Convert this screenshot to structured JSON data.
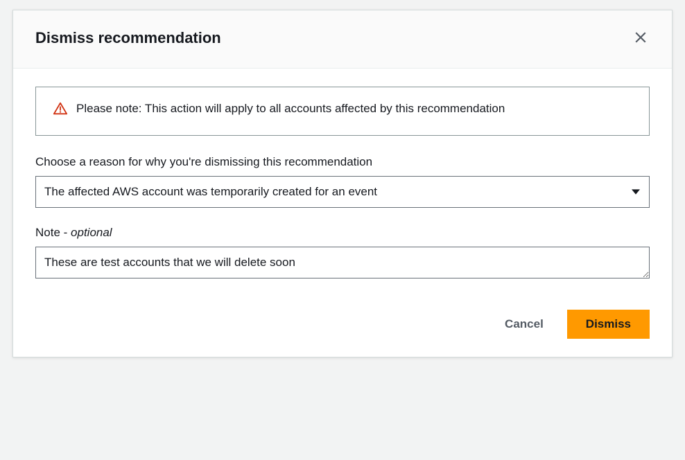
{
  "modal": {
    "title": "Dismiss recommendation",
    "alert_text": "Please note: This action will apply to all accounts affected by this recommendation",
    "reason_label": "Choose a reason for why you're dismissing this recommendation",
    "reason_selected": "The affected AWS account was temporarily created for an event",
    "note_label_prefix": "Note - ",
    "note_label_optional": "optional",
    "note_value": "These are test accounts that we will delete soon",
    "cancel_label": "Cancel",
    "dismiss_label": "Dismiss"
  }
}
